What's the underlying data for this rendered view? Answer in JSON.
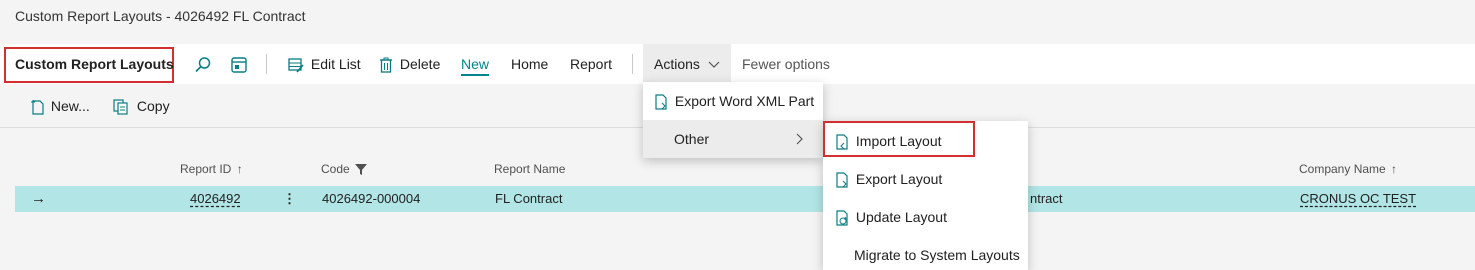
{
  "window": {
    "title": "Custom Report Layouts - 4026492 FL Contract"
  },
  "actionbar": {
    "page_caption": "Custom Report Layouts",
    "edit_list_label": "Edit List",
    "delete_label": "Delete",
    "new_label": "New",
    "home_label": "Home",
    "report_label": "Report",
    "actions_label": "Actions",
    "fewer_options_label": "Fewer options"
  },
  "subbar": {
    "new_label": "New...",
    "copy_label": "Copy"
  },
  "grid": {
    "columns": [
      "Report ID",
      "Code",
      "Report Name",
      "Company Name"
    ],
    "rows": [
      {
        "report_id": "4026492",
        "code": "4026492-000004",
        "report_name": "FL Contract",
        "description_visible": "ntract",
        "company_name": "CRONUS OC TEST"
      }
    ]
  },
  "actions_menu": {
    "items": [
      "Export Word XML Part",
      "Other"
    ]
  },
  "other_submenu": {
    "items": [
      "Import Layout",
      "Export Layout",
      "Update Layout",
      "Migrate to System Layouts"
    ]
  },
  "colors": {
    "accent": "#008489",
    "selected_row": "#b2e5e6",
    "highlight_border": "#d32f2f"
  }
}
